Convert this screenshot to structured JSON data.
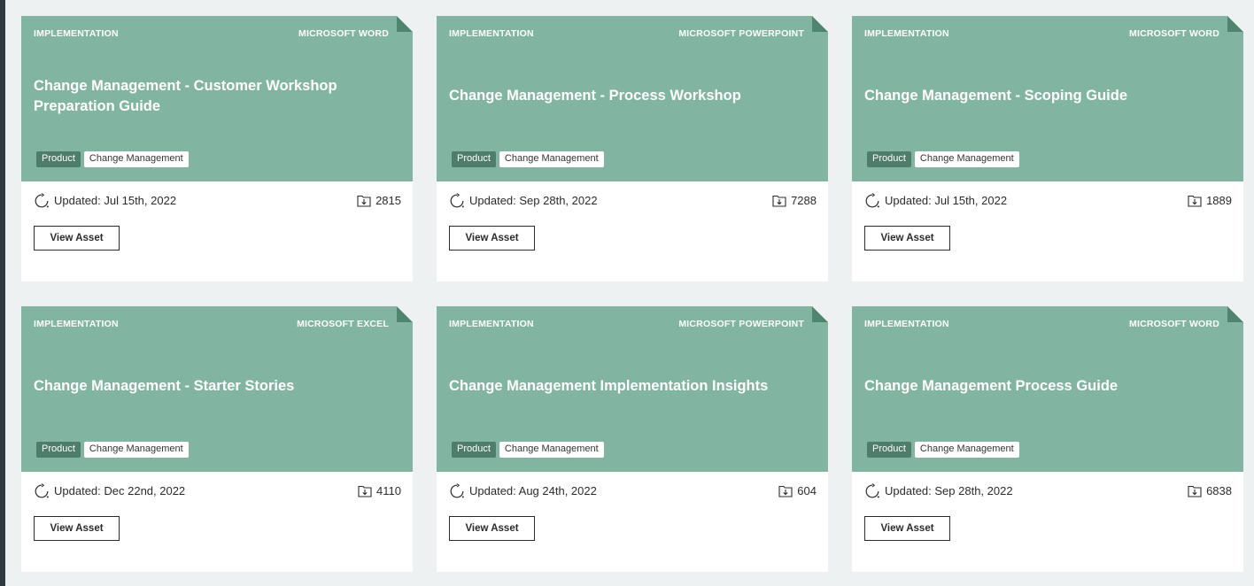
{
  "cards": [
    {
      "category": "IMPLEMENTATION",
      "file_type": "MICROSOFT WORD",
      "title": "Change Management - Customer Workshop Preparation Guide",
      "tags": [
        "Product",
        "Change Management"
      ],
      "updated": "Updated: Jul 15th, 2022",
      "downloads": "2815",
      "button_label": "View Asset"
    },
    {
      "category": "IMPLEMENTATION",
      "file_type": "MICROSOFT POWERPOINT",
      "title": "Change Management - Process Workshop",
      "tags": [
        "Product",
        "Change Management"
      ],
      "updated": "Updated: Sep 28th, 2022",
      "downloads": "7288",
      "button_label": "View Asset"
    },
    {
      "category": "IMPLEMENTATION",
      "file_type": "MICROSOFT WORD",
      "title": "Change Management - Scoping Guide",
      "tags": [
        "Product",
        "Change Management"
      ],
      "updated": "Updated: Jul 15th, 2022",
      "downloads": "1889",
      "button_label": "View Asset"
    },
    {
      "category": "IMPLEMENTATION",
      "file_type": "MICROSOFT EXCEL",
      "title": "Change Management - Starter Stories",
      "tags": [
        "Product",
        "Change Management"
      ],
      "updated": "Updated: Dec 22nd, 2022",
      "downloads": "4110",
      "button_label": "View Asset"
    },
    {
      "category": "IMPLEMENTATION",
      "file_type": "MICROSOFT POWERPOINT",
      "title": "Change Management Implementation Insights",
      "tags": [
        "Product",
        "Change Management"
      ],
      "updated": "Updated: Aug 24th, 2022",
      "downloads": "604",
      "button_label": "View Asset"
    },
    {
      "category": "IMPLEMENTATION",
      "file_type": "MICROSOFT WORD",
      "title": "Change Management Process Guide",
      "tags": [
        "Product",
        "Change Management"
      ],
      "updated": "Updated: Sep 28th, 2022",
      "downloads": "6838",
      "button_label": "View Asset"
    }
  ],
  "icons": {
    "updated": "refresh-icon",
    "downloads": "download-icon"
  },
  "colors": {
    "card_header": "#82b5a1",
    "product_tag": "#4e7d6a",
    "page_background": "#eef1f1"
  }
}
